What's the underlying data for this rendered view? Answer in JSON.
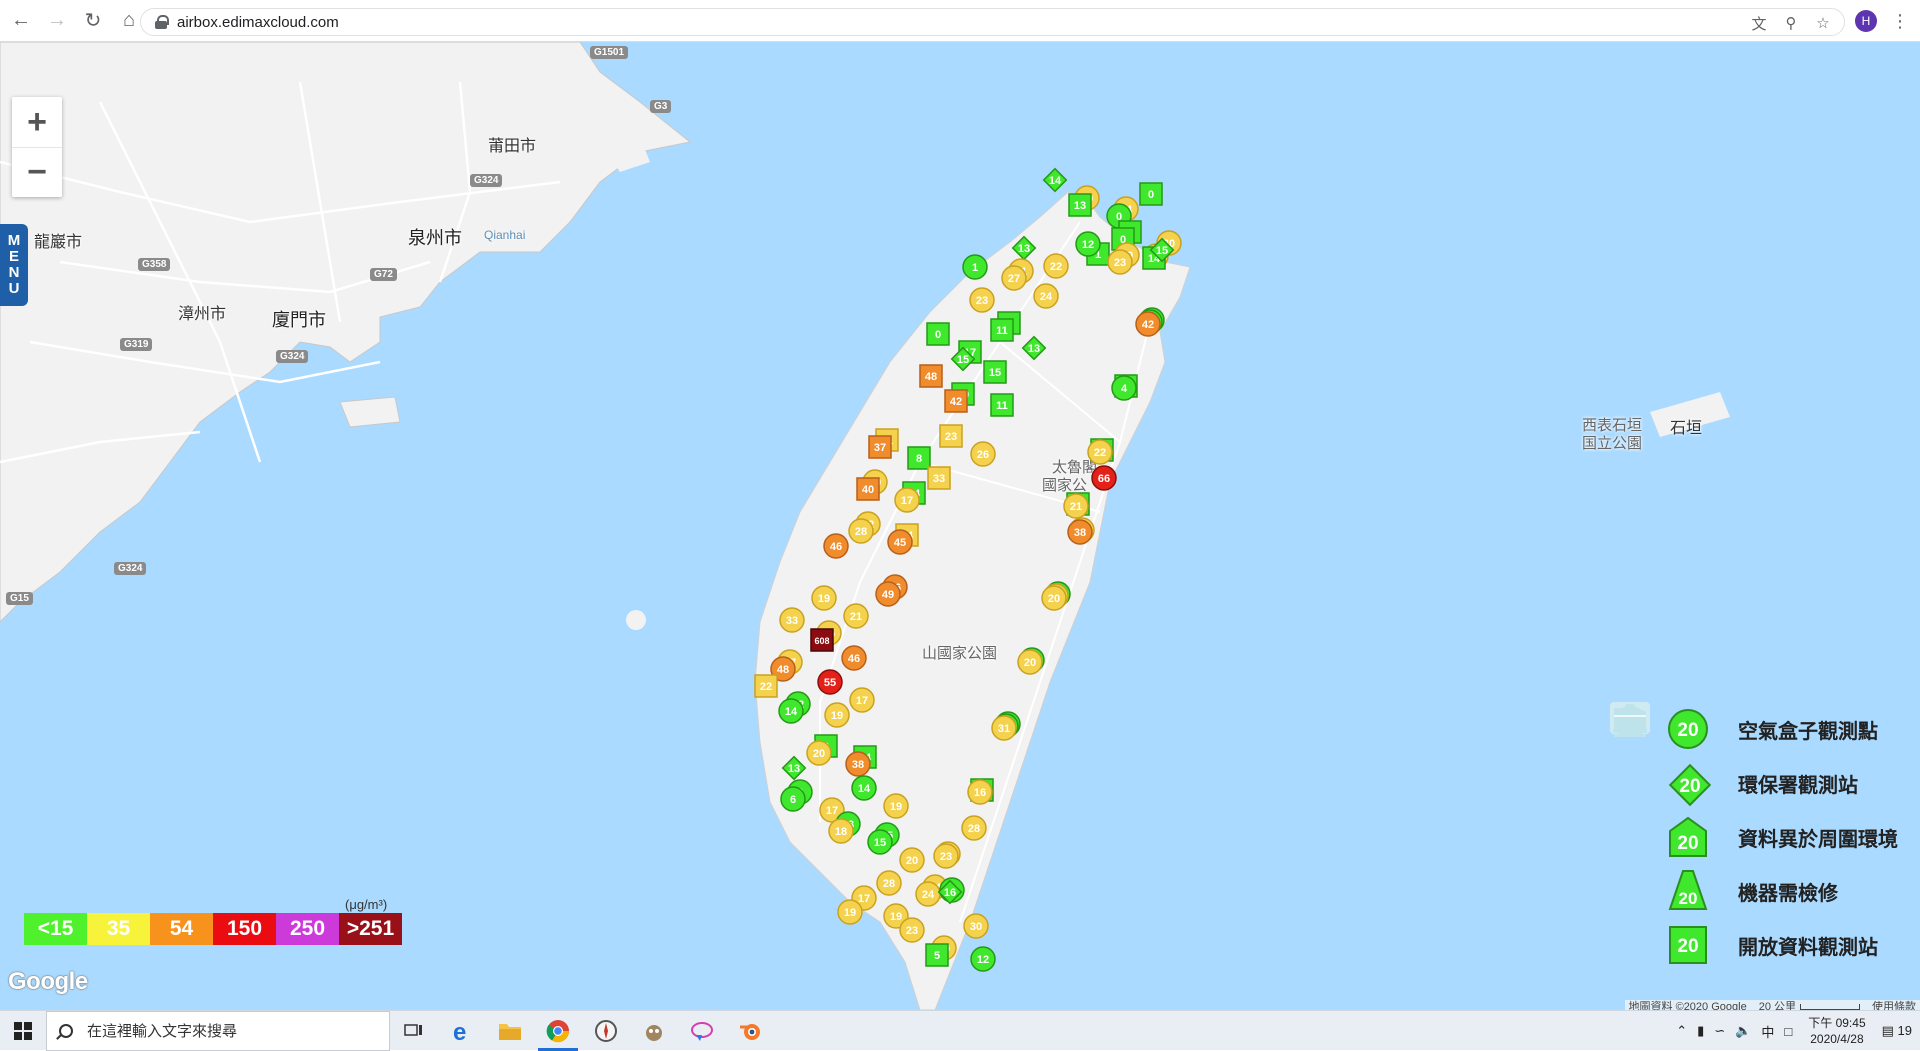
{
  "browser": {
    "url": "airbox.edimaxcloud.com",
    "profile_initial": "H"
  },
  "map": {
    "zoom_in": "+",
    "zoom_out": "−",
    "menu_label": [
      "M",
      "E",
      "N",
      "U"
    ],
    "cities": [
      {
        "name": "莆田市",
        "kind": "city"
      },
      {
        "name": "泉州市",
        "kind": "big"
      },
      {
        "name": "Qianhai",
        "kind": "en"
      },
      {
        "name": "漳州市",
        "kind": "city"
      },
      {
        "name": "廈門市",
        "kind": "big"
      },
      {
        "name": "龍巖市",
        "kind": "city"
      },
      {
        "name": "太魯閣",
        "kind": "park"
      },
      {
        "name": "國家公",
        "kind": "park"
      },
      {
        "name": "山國家公園",
        "kind": "park"
      },
      {
        "name": "西表石垣",
        "kind": "park"
      },
      {
        "name": "国立公園",
        "kind": "park"
      },
      {
        "name": "石垣",
        "kind": "city"
      }
    ],
    "roads": [
      "G1501",
      "G3",
      "G324",
      "G358",
      "G72",
      "G319",
      "G324",
      "G324",
      "G15"
    ],
    "markers": [
      {
        "v": 14,
        "lvl": 0,
        "shape": "diamond"
      },
      {
        "v": 24,
        "lvl": 1,
        "shape": "circle"
      },
      {
        "v": 20,
        "lvl": 1,
        "shape": "circle"
      },
      {
        "v": 17,
        "lvl": 1,
        "shape": "circle"
      },
      {
        "v": 0,
        "lvl": 0,
        "shape": "circle"
      },
      {
        "v": 13,
        "lvl": 0,
        "shape": "square"
      },
      {
        "v": 0,
        "lvl": 0,
        "shape": "square"
      },
      {
        "v": 14,
        "lvl": 0,
        "shape": "square"
      },
      {
        "v": 1,
        "lvl": 0,
        "shape": "square"
      },
      {
        "v": 30,
        "lvl": 1,
        "shape": "circle"
      },
      {
        "v": 9,
        "lvl": 0,
        "shape": "square"
      },
      {
        "v": 7,
        "lvl": 0,
        "shape": "circle"
      },
      {
        "v": 15,
        "lvl": 0,
        "shape": "diamond"
      },
      {
        "v": 0,
        "lvl": 0,
        "shape": "square"
      },
      {
        "v": 13,
        "lvl": 0,
        "shape": "diamond"
      },
      {
        "v": 10,
        "lvl": 0,
        "shape": "circle"
      },
      {
        "v": 22,
        "lvl": 1,
        "shape": "circle"
      },
      {
        "v": 19,
        "lvl": 1,
        "shape": "circle"
      },
      {
        "v": 12,
        "lvl": 0,
        "shape": "circle"
      },
      {
        "v": 42,
        "lvl": 2,
        "shape": "circle"
      },
      {
        "v": 23,
        "lvl": 1,
        "shape": "circle"
      },
      {
        "v": 21,
        "lvl": 1,
        "shape": "circle"
      },
      {
        "v": 23,
        "lvl": 1,
        "shape": "circle"
      },
      {
        "v": 13,
        "lvl": 0,
        "shape": "square"
      },
      {
        "v": 27,
        "lvl": 1,
        "shape": "circle"
      },
      {
        "v": 1,
        "lvl": 0,
        "shape": "circle"
      },
      {
        "v": 24,
        "lvl": 1,
        "shape": "circle"
      },
      {
        "v": 4,
        "lvl": 0,
        "shape": "circle"
      },
      {
        "v": 0,
        "lvl": 0,
        "shape": "square"
      },
      {
        "v": 5,
        "lvl": 0,
        "shape": "square"
      },
      {
        "v": 17,
        "lvl": 0,
        "shape": "square"
      },
      {
        "v": 8,
        "lvl": 0,
        "shape": "square"
      },
      {
        "v": 11,
        "lvl": 0,
        "shape": "square"
      },
      {
        "v": 15,
        "lvl": 0,
        "shape": "diamond"
      },
      {
        "v": 13,
        "lvl": 0,
        "shape": "diamond"
      },
      {
        "v": 22,
        "lvl": 1,
        "shape": "circle"
      },
      {
        "v": 48,
        "lvl": 2,
        "shape": "square"
      },
      {
        "v": 11,
        "lvl": 0,
        "shape": "square"
      },
      {
        "v": 10,
        "lvl": 0,
        "shape": "square"
      },
      {
        "v": 3,
        "lvl": 0,
        "shape": "square"
      },
      {
        "v": 15,
        "lvl": 0,
        "shape": "square"
      },
      {
        "v": 42,
        "lvl": 2,
        "shape": "square"
      },
      {
        "v": 31,
        "lvl": 1,
        "shape": "square"
      },
      {
        "v": 21,
        "lvl": 1,
        "shape": "circle"
      },
      {
        "v": 8,
        "lvl": 0,
        "shape": "square"
      },
      {
        "v": 37,
        "lvl": 2,
        "shape": "square"
      },
      {
        "v": 23,
        "lvl": 1,
        "shape": "square"
      },
      {
        "v": 66,
        "lvl": 3,
        "shape": "circle"
      },
      {
        "v": 26,
        "lvl": 1,
        "shape": "circle"
      },
      {
        "v": 14,
        "lvl": 0,
        "shape": "square"
      },
      {
        "v": 29,
        "lvl": 1,
        "shape": "circle"
      },
      {
        "v": 24,
        "lvl": 1,
        "shape": "circle"
      },
      {
        "v": 17,
        "lvl": 1,
        "shape": "circle"
      },
      {
        "v": 40,
        "lvl": 2,
        "shape": "square"
      },
      {
        "v": 33,
        "lvl": 1,
        "shape": "square"
      },
      {
        "v": 38,
        "lvl": 2,
        "shape": "circle"
      },
      {
        "v": 46,
        "lvl": 2,
        "shape": "circle"
      },
      {
        "v": 34,
        "lvl": 1,
        "shape": "square"
      },
      {
        "v": 22,
        "lvl": 1,
        "shape": "circle"
      },
      {
        "v": 3,
        "lvl": 0,
        "shape": "circle"
      },
      {
        "v": 45,
        "lvl": 2,
        "shape": "circle"
      },
      {
        "v": 28,
        "lvl": 1,
        "shape": "circle"
      },
      {
        "v": 33,
        "lvl": 1,
        "shape": "circle"
      },
      {
        "v": 29,
        "lvl": 1,
        "shape": "circle"
      },
      {
        "v": 19,
        "lvl": 1,
        "shape": "circle"
      },
      {
        "v": 36,
        "lvl": 2,
        "shape": "circle"
      },
      {
        "v": 21,
        "lvl": 1,
        "shape": "circle"
      },
      {
        "v": 20,
        "lvl": 1,
        "shape": "circle"
      },
      {
        "v": 49,
        "lvl": 2,
        "shape": "circle"
      },
      {
        "v": 35,
        "lvl": 1,
        "shape": "circle"
      },
      {
        "v": 27,
        "lvl": 1,
        "shape": "circle"
      },
      {
        "v": 0,
        "lvl": 0,
        "shape": "circle"
      },
      {
        "v": 608,
        "lvl": 5,
        "shape": "square"
      },
      {
        "v": 48,
        "lvl": 2,
        "shape": "circle"
      },
      {
        "v": 46,
        "lvl": 2,
        "shape": "circle"
      },
      {
        "v": 20,
        "lvl": 1,
        "shape": "circle"
      },
      {
        "v": 22,
        "lvl": 1,
        "shape": "square"
      },
      {
        "v": 19,
        "lvl": 1,
        "shape": "circle"
      },
      {
        "v": 12,
        "lvl": 0,
        "shape": "circle"
      },
      {
        "v": 0,
        "lvl": 0,
        "shape": "circle"
      },
      {
        "v": 55,
        "lvl": 3,
        "shape": "circle"
      },
      {
        "v": 14,
        "lvl": 0,
        "shape": "circle"
      },
      {
        "v": 17,
        "lvl": 1,
        "shape": "circle"
      },
      {
        "v": 4,
        "lvl": 0,
        "shape": "circle"
      },
      {
        "v": 13,
        "lvl": 0,
        "shape": "diamond"
      },
      {
        "v": 14,
        "lvl": 0,
        "shape": "square"
      },
      {
        "v": 9,
        "lvl": 0,
        "shape": "square"
      },
      {
        "v": 31,
        "lvl": 1,
        "shape": "circle"
      },
      {
        "v": 38,
        "lvl": 2,
        "shape": "circle"
      },
      {
        "v": 20,
        "lvl": 1,
        "shape": "circle"
      },
      {
        "v": 9,
        "lvl": 0,
        "shape": "circle"
      },
      {
        "v": 11,
        "lvl": 0,
        "shape": "square"
      },
      {
        "v": 17,
        "lvl": 1,
        "shape": "circle"
      },
      {
        "v": 6,
        "lvl": 0,
        "shape": "circle"
      },
      {
        "v": 14,
        "lvl": 0,
        "shape": "circle"
      },
      {
        "v": 16,
        "lvl": 1,
        "shape": "circle"
      },
      {
        "v": 19,
        "lvl": 1,
        "shape": "circle"
      },
      {
        "v": 15,
        "lvl": 0,
        "shape": "circle"
      },
      {
        "v": 13,
        "lvl": 0,
        "shape": "circle"
      },
      {
        "v": 24,
        "lvl": 1,
        "shape": "circle"
      },
      {
        "v": 15,
        "lvl": 0,
        "shape": "circle"
      },
      {
        "v": 18,
        "lvl": 1,
        "shape": "circle"
      },
      {
        "v": 20,
        "lvl": 1,
        "shape": "circle"
      },
      {
        "v": 23,
        "lvl": 1,
        "shape": "circle"
      },
      {
        "v": 17,
        "lvl": 1,
        "shape": "circle"
      },
      {
        "v": 24,
        "lvl": 1,
        "shape": "circle"
      },
      {
        "v": 19,
        "lvl": 1,
        "shape": "circle"
      },
      {
        "v": 28,
        "lvl": 1,
        "shape": "circle"
      },
      {
        "v": 24,
        "lvl": 1,
        "shape": "circle"
      },
      {
        "v": 28,
        "lvl": 1,
        "shape": "circle"
      },
      {
        "v": 19,
        "lvl": 1,
        "shape": "circle"
      },
      {
        "v": 15,
        "lvl": 0,
        "shape": "circle"
      },
      {
        "v": 23,
        "lvl": 1,
        "shape": "circle"
      },
      {
        "v": 12,
        "lvl": 0,
        "shape": "circle"
      },
      {
        "v": 20,
        "lvl": 1,
        "shape": "circle"
      },
      {
        "v": 16,
        "lvl": 0,
        "shape": "diamond"
      },
      {
        "v": 30,
        "lvl": 1,
        "shape": "circle"
      },
      {
        "v": 5,
        "lvl": 0,
        "shape": "square"
      }
    ]
  },
  "legend": {
    "items": [
      {
        "icon": "cloud-icon",
        "shape": "circle",
        "value": "20",
        "label": "空氣盒子觀測點"
      },
      {
        "icon": "government-building-icon",
        "shape": "diamond",
        "value": "20",
        "label": "環保署觀測站"
      },
      {
        "icon": "house-icon",
        "shape": "house",
        "value": "20",
        "label": "資料異於周圍環境"
      },
      {
        "icon": "cone-icon",
        "shape": "cone",
        "value": "20",
        "label": "機器需檢修"
      },
      {
        "icon": "folder-icon",
        "shape": "square",
        "value": "20",
        "label": "開放資料觀測站"
      }
    ]
  },
  "pm_scale": {
    "unit": "(μg/m³)",
    "levels": [
      {
        "label": "<15",
        "color": "#4ef12b"
      },
      {
        "label": "35",
        "color": "#f6f33a"
      },
      {
        "label": "54",
        "color": "#f7931d"
      },
      {
        "label": "150",
        "color": "#eb0c11"
      },
      {
        "label": "250",
        "color": "#cc3bd9"
      },
      {
        "label": ">251",
        "color": "#991019"
      }
    ]
  },
  "map_footer": {
    "google": "Google",
    "attribution": "地圖資料 ©2020 Google",
    "scale": "20 公里",
    "terms": "使用條款"
  },
  "taskbar": {
    "search_placeholder": "在這裡輸入文字來搜尋",
    "ime": "中",
    "time": "下午 09:45",
    "date": "2020/4/28",
    "notifications": "19"
  },
  "colors": {
    "level_fill": [
      "#3fe82c",
      "#f5d24e",
      "#f08c2c",
      "#e32119",
      "#cc3bd9",
      "#8b0d12"
    ],
    "sea": "#aadaff",
    "land": "#f2f2f2"
  }
}
